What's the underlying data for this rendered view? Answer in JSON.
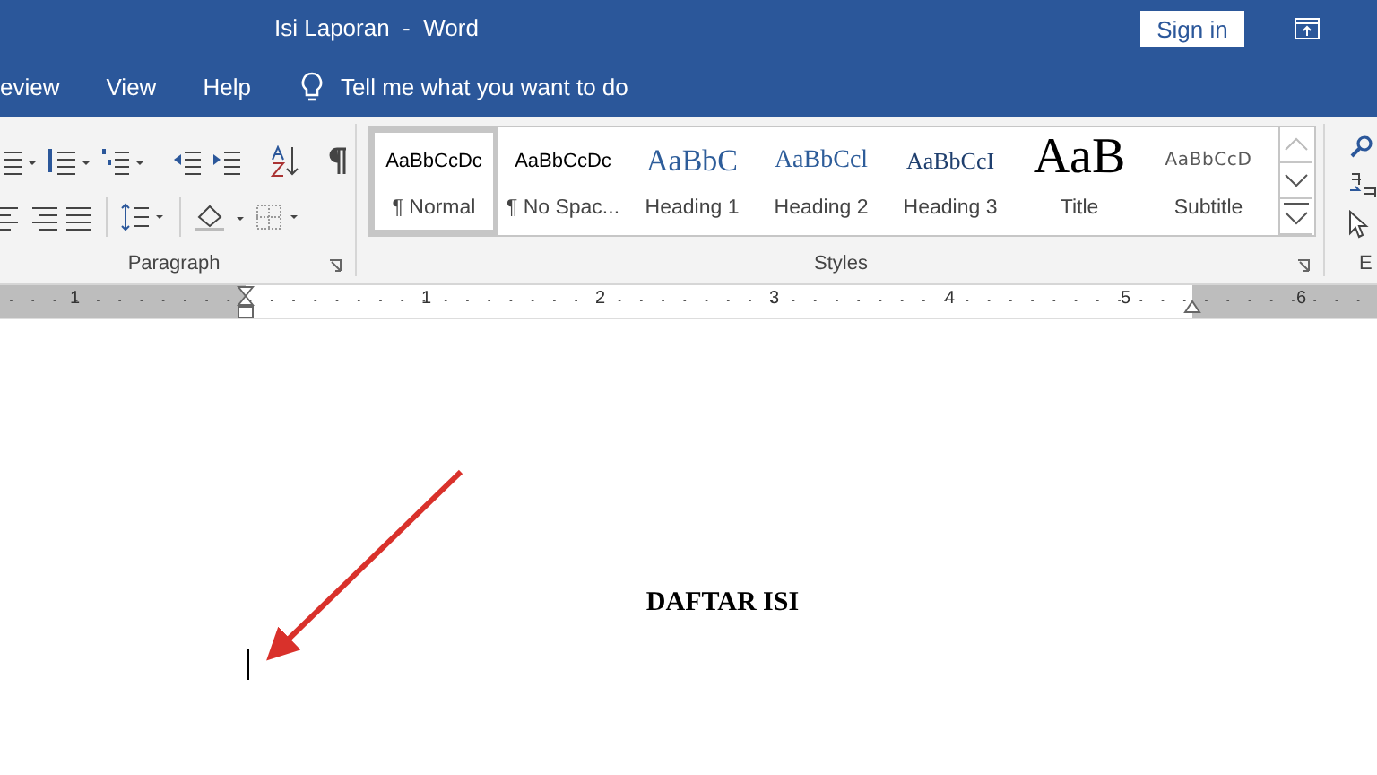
{
  "window": {
    "title": "Isi Laporan  -  Word",
    "sign_in": "Sign in"
  },
  "tabs": [
    {
      "label": "eview",
      "selected": false
    },
    {
      "label": "View",
      "selected": false
    },
    {
      "label": "Help",
      "selected": false
    }
  ],
  "tell_me": {
    "placeholder": "Tell me what you want to do"
  },
  "paragraph_group": {
    "label": "Paragraph"
  },
  "styles_group": {
    "label": "Styles",
    "items": [
      {
        "preview": "AaBbCcDc",
        "name": "¶ Normal",
        "kind": "normal",
        "selected": true
      },
      {
        "preview": "AaBbCcDc",
        "name": "¶ No Spac...",
        "kind": "normal",
        "selected": false
      },
      {
        "preview": "AaBbC",
        "name": "Heading 1",
        "kind": "heading1",
        "selected": false
      },
      {
        "preview": "AaBbCcl",
        "name": "Heading 2",
        "kind": "heading2",
        "selected": false
      },
      {
        "preview": "AaBbCcI",
        "name": "Heading 3",
        "kind": "heading3",
        "selected": false
      },
      {
        "preview": "AaB",
        "name": "Title",
        "kind": "title",
        "selected": false
      },
      {
        "preview": "AaBbCcD",
        "name": "Subtitle",
        "kind": "subtitle",
        "selected": false
      }
    ]
  },
  "editing_group": {
    "label": "E"
  },
  "ruler": {
    "numbers": [
      "1",
      "1",
      "2",
      "3",
      "4",
      "5",
      "6"
    ]
  },
  "document": {
    "heading": "DAFTAR ISI"
  }
}
